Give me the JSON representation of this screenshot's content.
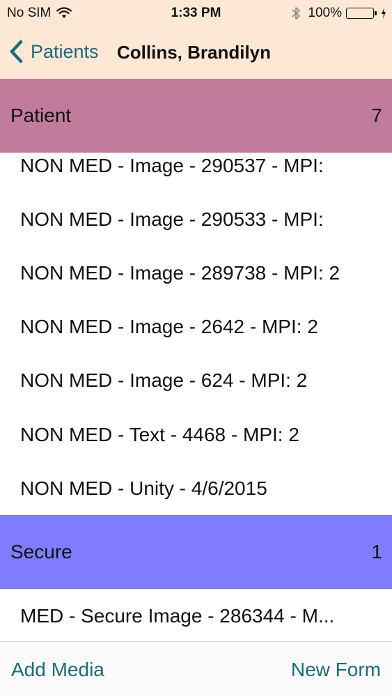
{
  "status_bar": {
    "carrier": "No SIM",
    "time": "1:33 PM",
    "battery_percent": "100%",
    "battery_level": 1.0,
    "icons": [
      "wifi-icon",
      "bluetooth-icon",
      "battery-icon",
      "charging-icon"
    ]
  },
  "nav": {
    "back_label": "Patients",
    "title": "Collins, Brandilyn"
  },
  "sections": {
    "patient": {
      "title": "Patient",
      "count": "7",
      "color": "#c17c9c",
      "items": [
        "NON MED - Image - 290537 - MPI:",
        "NON MED - Image - 290533 - MPI:",
        "NON MED - Image - 289738 - MPI: 2",
        "NON MED - Image - 2642 - MPI: 2",
        "NON MED - Image - 624 - MPI: 2",
        "NON MED - Text - 4468 - MPI: 2",
        "NON MED - Unity - 4/6/2015"
      ]
    },
    "secure": {
      "title": "Secure",
      "count": "1",
      "color": "#7f7cff",
      "items": [
        "MED - Secure Image - 286344 - M..."
      ]
    }
  },
  "toolbar": {
    "add_media": "Add Media",
    "new_form": "New Form"
  },
  "colors": {
    "accent": "#1a6b78",
    "nav_background": "#fce8d4"
  }
}
